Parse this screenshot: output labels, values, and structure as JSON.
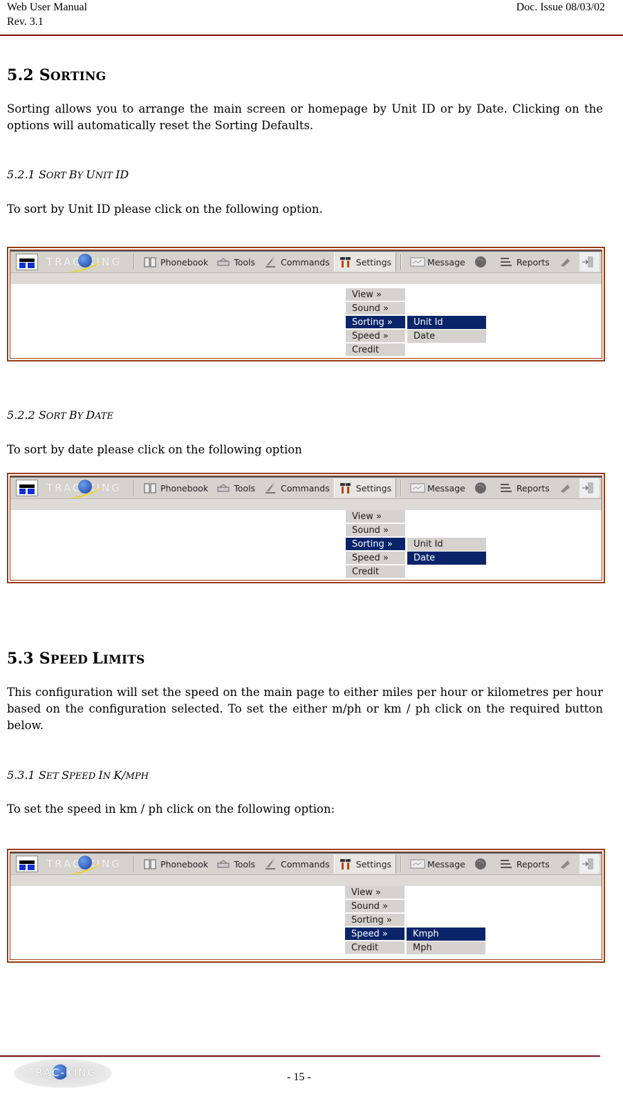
{
  "header": {
    "title": "Web User Manual",
    "revision": "Rev. 3.1",
    "doc_issue": "Doc. Issue 08/03/02"
  },
  "section_5_2": {
    "number": "5.2",
    "title_first": "S",
    "title_rest": "ORTING",
    "intro": "Sorting allows you to arrange the main screen or homepage by Unit ID  or by Date. Clicking on the options will automatically reset the Sorting Defaults.",
    "sub1": {
      "number": "5.2.1",
      "parts": [
        "S",
        "ORT ",
        "B",
        "Y ",
        "U",
        "NIT ",
        "ID"
      ],
      "text": "To sort by Unit ID please click on the following option."
    },
    "sub2": {
      "number": "5.2.2",
      "parts": [
        "S",
        "ORT ",
        "B",
        "Y ",
        "D",
        "ATE"
      ],
      "text": "To sort by date please click on the following option"
    }
  },
  "section_5_3": {
    "number": "5.3",
    "title_parts": [
      "S",
      "PEED ",
      "L",
      "IMITS"
    ],
    "intro": "This configuration will set the speed on the main page to either miles per hour or kilometres per hour based on the configuration selected.  To set the either m/ph or km / ph click on the required button below.",
    "sub1": {
      "number": "5.3.1",
      "parts": [
        "S",
        "ET ",
        "S",
        "PEED ",
        "I",
        "N ",
        "K/",
        "MPH"
      ],
      "text": "To set the speed in km / ph click on the following option:"
    }
  },
  "toolbar": {
    "brand": "TRAC-KING",
    "items": [
      "Phonebook",
      "Tools",
      "Commands",
      "Settings",
      "Message",
      "Reports"
    ],
    "active": "Settings"
  },
  "menu": {
    "items": [
      "View  »",
      "Sound  »",
      "Sorting  »",
      "Speed  »",
      "Credit"
    ]
  },
  "screens": [
    {
      "menu_selected": "Sorting",
      "submenu": [
        "Unit Id",
        "Date"
      ],
      "submenu_selected": "Unit Id"
    },
    {
      "menu_selected": "Sorting",
      "submenu": [
        "Unit Id",
        "Date"
      ],
      "submenu_selected": "Date"
    },
    {
      "menu_selected": "Speed",
      "submenu": [
        "Kmph",
        "Mph"
      ],
      "submenu_selected": "Kmph"
    }
  ],
  "footer": {
    "page_number": "- 15 -",
    "logo_text": "TRAC-KING"
  },
  "colors": {
    "rule": "#7a0d0d",
    "frame_border": "#9a3a12",
    "menu_selected_bg": "#0a246a",
    "menu_bg": "#d6d3ce"
  }
}
